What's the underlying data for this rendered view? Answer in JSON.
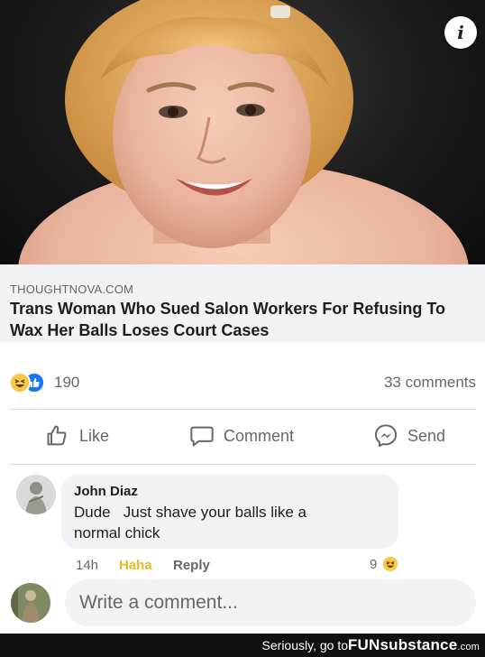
{
  "link_preview": {
    "source": "THOUGHTNOVA.COM",
    "headline": "Trans Woman Who Sued Salon Workers For Refusing To Wax Her Balls Loses Court Cases"
  },
  "post_stats": {
    "reaction_count": "190",
    "comments_count": "33 comments",
    "reaction_icons": [
      "haha-icon",
      "like-icon"
    ]
  },
  "actions": {
    "like_label": "Like",
    "comment_label": "Comment",
    "send_label": "Send"
  },
  "comment": {
    "author": "John Diaz",
    "text": "Dude   Just shave your balls like a normal chick",
    "time": "14h",
    "reaction_label": "Haha",
    "reply_label": "Reply",
    "reaction_count": "9"
  },
  "composer": {
    "placeholder": "Write a comment..."
  },
  "watermark": {
    "text": "Seriously, go to",
    "logo_main": "FUNsubstance",
    "logo_suffix": ".com"
  },
  "colors": {
    "haha_yellow": "#f7c843",
    "like_blue": "#1877f2",
    "haha_text": "#e8b826",
    "secondary_text": "#65676b"
  }
}
